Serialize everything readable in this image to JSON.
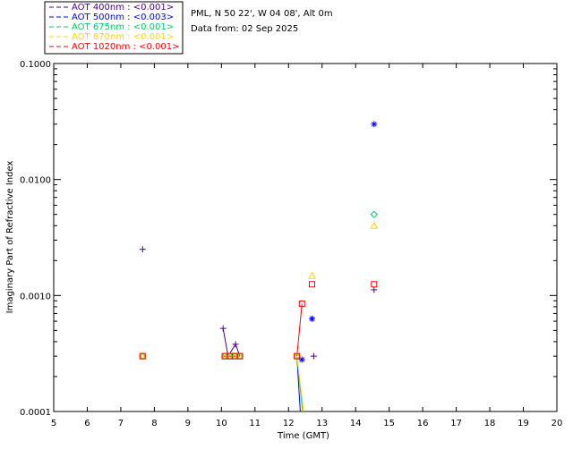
{
  "header": {
    "site": "PML, N 50 22', W 04 08', Alt 0m",
    "date_line": "Data from: 02 Sep 2025"
  },
  "legend": [
    {
      "label": "AOT  400nm : <0.001>",
      "color": "#4b0082"
    },
    {
      "label": "AOT  500nm : <0.003>",
      "color": "#0000ff"
    },
    {
      "label": "AOT  675nm : <0.001>",
      "color": "#00cc66"
    },
    {
      "label": "AOT  870nm : <0.001>",
      "color": "#ffd700"
    },
    {
      "label": "AOT 1020nm : <0.001>",
      "color": "#ff0000"
    }
  ],
  "chart_data": {
    "type": "scatter",
    "xlabel": "Time (GMT)",
    "ylabel": "Imaginary Part of Refractive Index",
    "xlim": [
      5,
      20
    ],
    "ylim": [
      0.0001,
      0.1
    ],
    "y_scale": "log",
    "x_ticks": [
      "5",
      "6",
      "7",
      "8",
      "9",
      "10",
      "11",
      "12",
      "13",
      "14",
      "15",
      "16",
      "17",
      "18",
      "19",
      "20"
    ],
    "y_ticks": [
      "0.0001",
      "0.0010",
      "0.0100",
      "0.1000"
    ],
    "grid": false,
    "legend_position": "above-top-left",
    "series": [
      {
        "name": "AOT  400nm : <0.001>",
        "marker": "plus",
        "color": "#4b0082",
        "points": [
          [
            7.65,
            0.0025
          ],
          [
            10.05,
            0.00052
          ],
          [
            10.42,
            0.00038
          ],
          [
            12.75,
            0.0003
          ],
          [
            14.55,
            0.00112
          ]
        ],
        "lines": [
          [
            [
              10.05,
              0.00052
            ],
            [
              10.2,
              0.0003
            ],
            [
              10.42,
              0.00038
            ],
            [
              10.55,
              0.0003
            ]
          ]
        ]
      },
      {
        "name": "AOT  500nm : <0.003>",
        "marker": "asterisk",
        "color": "#0000ff",
        "points": [
          [
            12.4,
            0.00028
          ],
          [
            12.7,
            0.00063
          ],
          [
            14.55,
            0.03
          ]
        ],
        "lines": [
          [
            [
              12.25,
              0.0003
            ],
            [
              12.35,
              0.0001
            ]
          ]
        ]
      },
      {
        "name": "AOT  675nm : <0.001>",
        "marker": "diamond",
        "color": "#00cc66",
        "points": [
          [
            7.65,
            0.0003
          ],
          [
            10.1,
            0.0003
          ],
          [
            10.25,
            0.0003
          ],
          [
            10.4,
            0.0003
          ],
          [
            10.55,
            0.0003
          ],
          [
            12.25,
            0.0003
          ],
          [
            14.55,
            0.005
          ]
        ],
        "lines": [
          [
            [
              12.25,
              0.0003
            ],
            [
              12.42,
              0.0001
            ]
          ]
        ]
      },
      {
        "name": "AOT  870nm : <0.001>",
        "marker": "triangle",
        "color": "#ffd700",
        "points": [
          [
            7.65,
            0.0003
          ],
          [
            10.1,
            0.0003
          ],
          [
            10.25,
            0.0003
          ],
          [
            10.4,
            0.0003
          ],
          [
            10.55,
            0.0003
          ],
          [
            12.25,
            0.0003
          ],
          [
            12.7,
            0.00148
          ],
          [
            14.55,
            0.004
          ]
        ],
        "lines": [
          [
            [
              10.05,
              0.0003
            ],
            [
              10.55,
              0.0003
            ]
          ],
          [
            [
              12.25,
              0.0003
            ],
            [
              12.45,
              0.0001
            ]
          ]
        ]
      },
      {
        "name": "AOT 1020nm : <0.001>",
        "marker": "square",
        "color": "#ff0000",
        "points": [
          [
            7.65,
            0.0003
          ],
          [
            10.1,
            0.0003
          ],
          [
            10.25,
            0.0003
          ],
          [
            10.4,
            0.0003
          ],
          [
            10.55,
            0.0003
          ],
          [
            12.25,
            0.0003
          ],
          [
            12.4,
            0.00085
          ],
          [
            12.7,
            0.00125
          ],
          [
            14.55,
            0.00125
          ]
        ],
        "lines": [
          [
            [
              10.05,
              0.0003
            ],
            [
              10.55,
              0.0003
            ]
          ],
          [
            [
              12.25,
              0.0003
            ],
            [
              12.4,
              0.00085
            ]
          ]
        ]
      }
    ]
  }
}
